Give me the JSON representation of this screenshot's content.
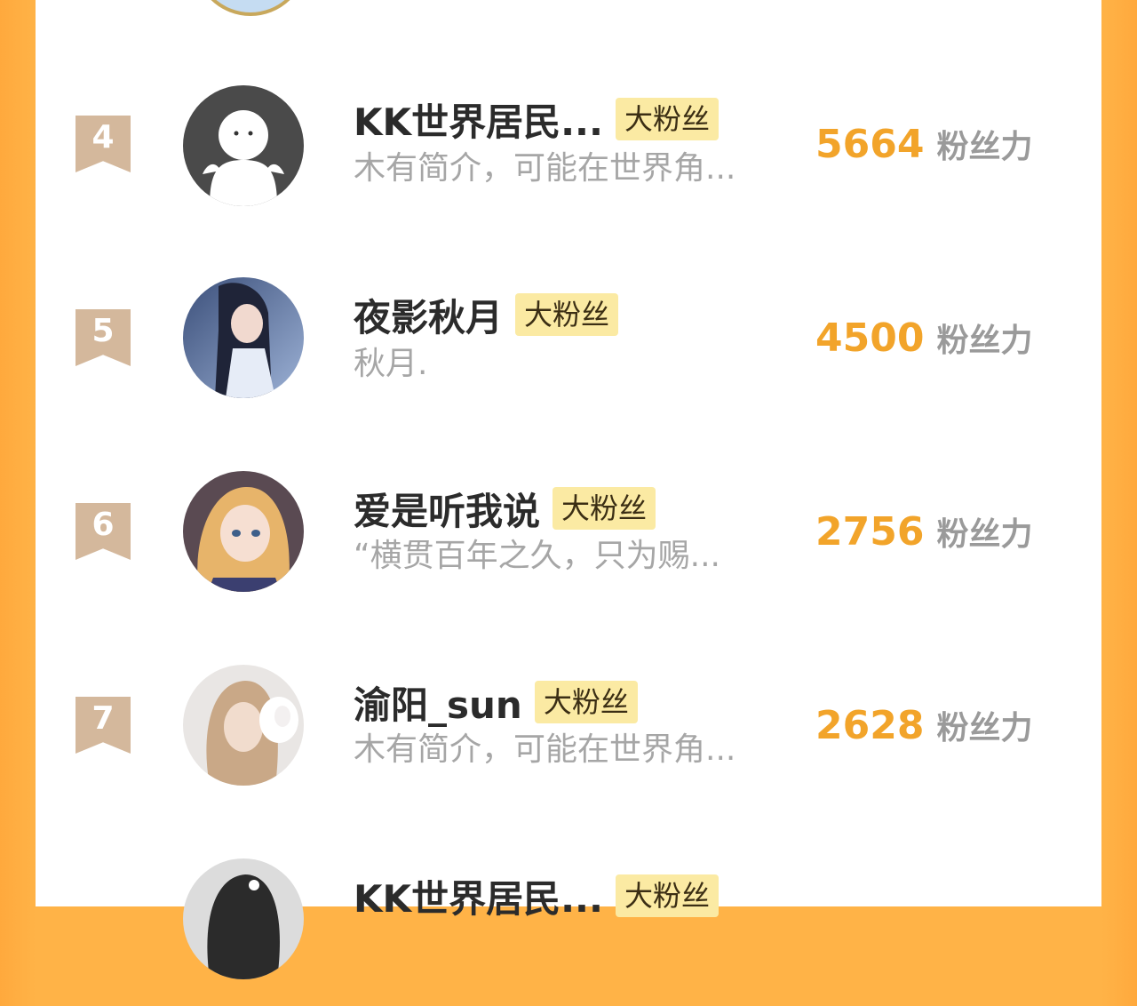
{
  "ranking": {
    "score_unit": "粉丝力",
    "rows": [
      {
        "rank": "4",
        "name": "KK世界居民...",
        "badge": "大粉丝",
        "desc": "木有简介，可能在世界角...",
        "score": "5664",
        "avatar_icon": "default-avatar-icon"
      },
      {
        "rank": "5",
        "name": "夜影秋月",
        "badge": "大粉丝",
        "desc": "秋月.",
        "score": "4500",
        "avatar_icon": "anime-avatar-icon"
      },
      {
        "rank": "6",
        "name": "爱是听我说",
        "badge": "大粉丝",
        "desc": "“横贯百年之久，只为赐...",
        "score": "2756",
        "avatar_icon": "anime-avatar-icon"
      },
      {
        "rank": "7",
        "name": "渝阳_sun",
        "badge": "大粉丝",
        "desc": "木有简介，可能在世界角...",
        "score": "2628",
        "avatar_icon": "photo-avatar-icon"
      },
      {
        "rank": "",
        "name": "KK世界居民...",
        "badge": "大粉丝",
        "desc": "",
        "score": "",
        "avatar_icon": "photo-avatar-icon"
      }
    ]
  },
  "colors": {
    "page_orange": "#ffb347",
    "score_orange": "#f2a42a",
    "badge_bg": "#fbeaa3",
    "rank_tag": "#d4b89c"
  }
}
